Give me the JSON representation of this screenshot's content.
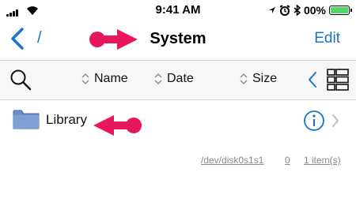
{
  "status_bar": {
    "time": "9:41 AM",
    "battery": "00%",
    "battery_fill_fraction": 1.0,
    "icons": [
      "signal-bars-icon",
      "wifi-icon",
      "location-arrow-icon",
      "alarm-clock-icon",
      "bluetooth-icon",
      "battery-icon"
    ]
  },
  "nav": {
    "path": "/",
    "title": "System",
    "edit_label": "Edit"
  },
  "sort_bar": {
    "name_label": "Name",
    "date_label": "Date",
    "size_label": "Size"
  },
  "rows": [
    {
      "label": "Library",
      "icon": "folder-icon"
    }
  ],
  "footer": {
    "device_path": "/dev/disk0s1s1",
    "count": "0",
    "items": "1 item(s)"
  },
  "colors": {
    "accent": "#1a73c9",
    "annotation": "#e8175d",
    "folder": "#6a8fc8",
    "battery": "#4cd964"
  }
}
